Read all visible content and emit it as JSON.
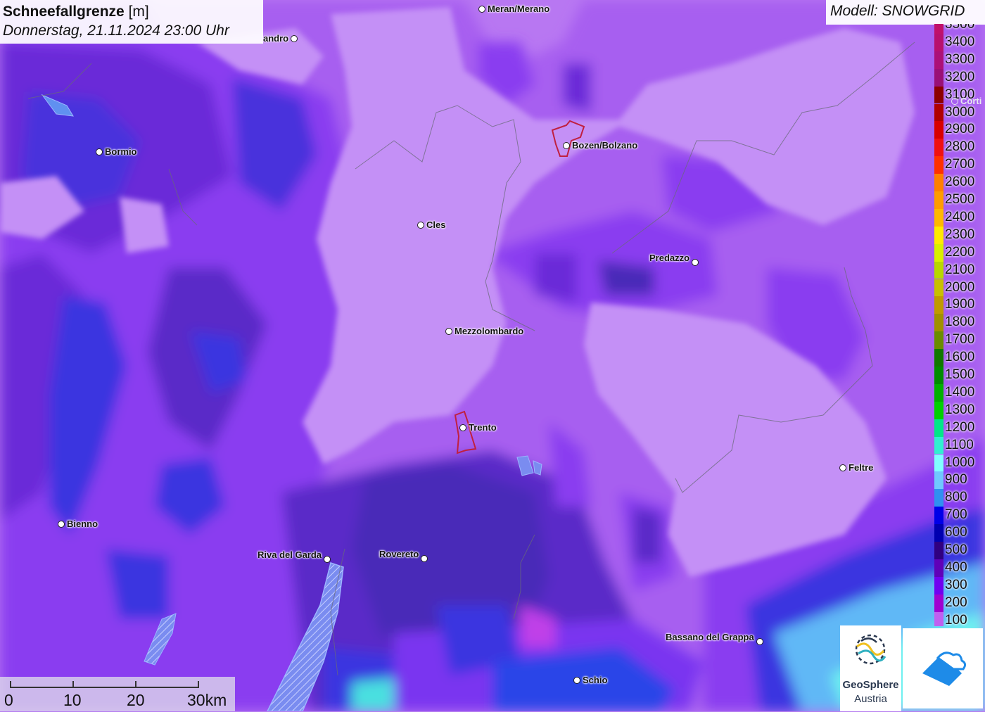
{
  "title": {
    "param": "Schneefallgrenze",
    "unit": " [m]",
    "datetime": "Donnerstag, 21.11.2024 23:00 Uhr"
  },
  "model": "Modell: SNOWGRID",
  "legend": [
    {
      "label": "3500",
      "color": "#c0106a"
    },
    {
      "label": "3400",
      "color": "#b8106e"
    },
    {
      "label": "3300",
      "color": "#ac1077"
    },
    {
      "label": "3200",
      "color": "#9a1076"
    },
    {
      "label": "3100",
      "color": "#8c0000"
    },
    {
      "label": "3000",
      "color": "#b00000"
    },
    {
      "label": "2900",
      "color": "#d80000"
    },
    {
      "label": "2800",
      "color": "#f01010"
    },
    {
      "label": "2700",
      "color": "#ff3000"
    },
    {
      "label": "2600",
      "color": "#ff8000"
    },
    {
      "label": "2500",
      "color": "#ff9c00"
    },
    {
      "label": "2400",
      "color": "#ffb800"
    },
    {
      "label": "2300",
      "color": "#ffea00"
    },
    {
      "label": "2200",
      "color": "#d8f000"
    },
    {
      "label": "2100",
      "color": "#b8d800"
    },
    {
      "label": "2000",
      "color": "#c8c000"
    },
    {
      "label": "1900",
      "color": "#c09a00"
    },
    {
      "label": "1800",
      "color": "#a09000"
    },
    {
      "label": "1700",
      "color": "#6a8c00"
    },
    {
      "label": "1600",
      "color": "#107800"
    },
    {
      "label": "1500",
      "color": "#008c00"
    },
    {
      "label": "1400",
      "color": "#00b000"
    },
    {
      "label": "1300",
      "color": "#00d000"
    },
    {
      "label": "1200",
      "color": "#00e888"
    },
    {
      "label": "1100",
      "color": "#30f0d0"
    },
    {
      "label": "1000",
      "color": "#80ffff"
    },
    {
      "label": "900",
      "color": "#70c8ff"
    },
    {
      "label": "800",
      "color": "#3090f0"
    },
    {
      "label": "700",
      "color": "#0000e8"
    },
    {
      "label": "600",
      "color": "#0000b0"
    },
    {
      "label": "500",
      "color": "#300080"
    },
    {
      "label": "400",
      "color": "#6000b8"
    },
    {
      "label": "300",
      "color": "#7000f0"
    },
    {
      "label": "200",
      "color": "#a000d0"
    },
    {
      "label": "100",
      "color": "#c060f0"
    }
  ],
  "cities": [
    {
      "name": "Meran/Merano",
      "label_side": "right"
    },
    {
      "name": "andro",
      "label_side": "left"
    },
    {
      "name": "Bormio",
      "label_side": "right"
    },
    {
      "name": "Bozen/Bolzano",
      "label_side": "right"
    },
    {
      "name": "Cles",
      "label_side": "right"
    },
    {
      "name": "Predazzo",
      "label_side": "left"
    },
    {
      "name": "Mezzolombardo",
      "label_side": "right"
    },
    {
      "name": "Trento",
      "label_side": "right"
    },
    {
      "name": "Feltre",
      "label_side": "right"
    },
    {
      "name": "Bienno",
      "label_side": "right"
    },
    {
      "name": "Riva del Garda",
      "label_side": "left"
    },
    {
      "name": "Rovereto",
      "label_side": "left"
    },
    {
      "name": "Bassano del Grappa",
      "label_side": "left"
    },
    {
      "name": "Schio",
      "label_side": "right"
    },
    {
      "name": "Corti",
      "label_side": "right"
    }
  ],
  "scale": {
    "labels": [
      "0",
      "10",
      "20",
      "30km"
    ]
  },
  "logos": {
    "geosphere_line1": "GeoSphere",
    "geosphere_line2": "Austria"
  }
}
